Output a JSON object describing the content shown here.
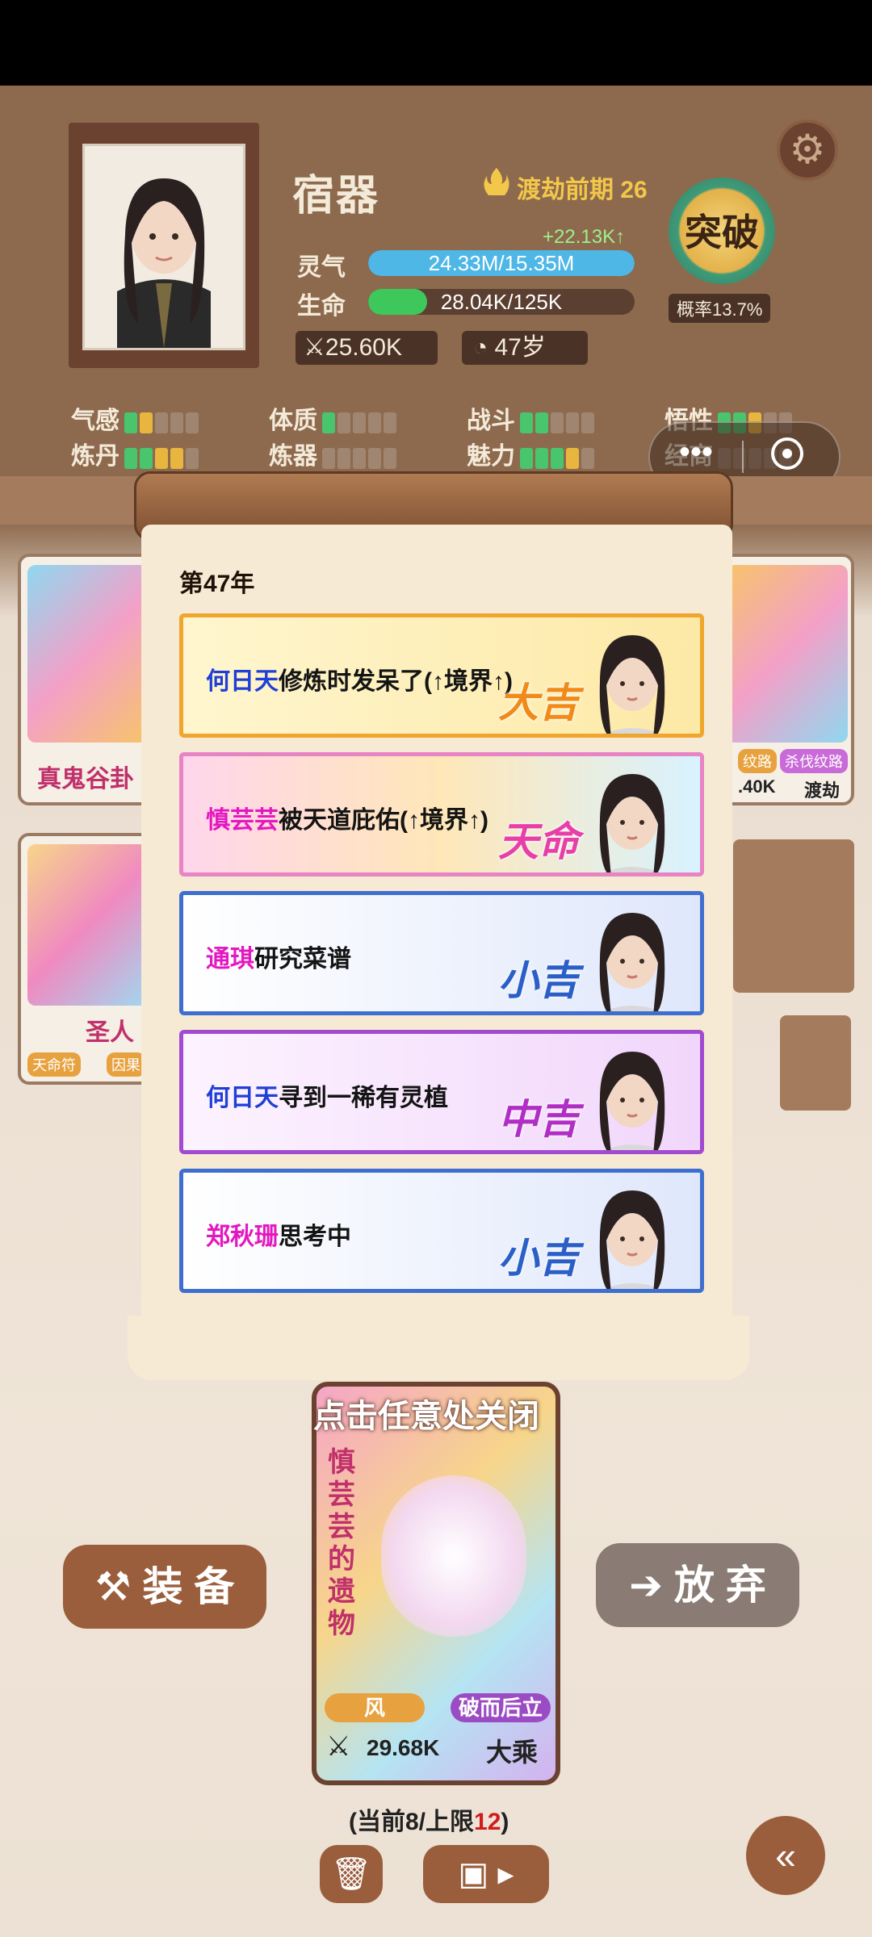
{
  "character": {
    "name": "宿器",
    "realm": "渡劫前期 26",
    "qi_gain": "+22.13K↑",
    "qi_label": "灵气",
    "qi_value": "24.33M/15.35M",
    "qi_fill": 1.0,
    "hp_label": "生命",
    "hp_value": "28.04K/125K",
    "hp_fill": 0.22,
    "power": "25.60K",
    "age": "47岁",
    "breakthrough_label": "突破",
    "breakthrough_prob": "概率13.7%"
  },
  "attributes": [
    {
      "label": "气感",
      "pips": [
        "g",
        "y",
        "n",
        "n",
        "n"
      ]
    },
    {
      "label": "体质",
      "pips": [
        "g",
        "n",
        "n",
        "n",
        "n"
      ]
    },
    {
      "label": "战斗",
      "pips": [
        "g",
        "g",
        "n",
        "n",
        "n"
      ]
    },
    {
      "label": "悟性",
      "pips": [
        "g",
        "g",
        "y",
        "n",
        "n"
      ]
    },
    {
      "label": "炼丹",
      "pips": [
        "g",
        "g",
        "y",
        "y",
        "n"
      ]
    },
    {
      "label": "炼器",
      "pips": [
        "n",
        "n",
        "n",
        "n",
        "n"
      ]
    },
    {
      "label": "魅力",
      "pips": [
        "g",
        "g",
        "g",
        "y",
        "n"
      ]
    },
    {
      "label": "经商",
      "pips": [
        "n",
        "n",
        "n",
        "n",
        "n"
      ]
    }
  ],
  "background": {
    "card1_label": "真鬼谷卦",
    "card2_label": "圣人",
    "card2_tags": [
      "天命符",
      "因果"
    ],
    "card3_tags": [
      "纹路",
      "杀伐纹路"
    ],
    "card3_stats": [
      ".40K",
      "渡劫"
    ]
  },
  "log": {
    "year": "第47年",
    "events": [
      {
        "name": "何日天",
        "name_color": "#1f3fd6",
        "text": "修炼时发呆了(↑境界↑)",
        "tag": "大吉",
        "tag_color": "#f08a18",
        "theme": "gold"
      },
      {
        "name": "慎芸芸",
        "name_color": "#e418c0",
        "text": "被天道庇佑(↑境界↑)",
        "tag": "天命",
        "tag_color": "#e83ea8",
        "theme": "rainbow"
      },
      {
        "name": "通琪",
        "name_color": "#e418c0",
        "text": "研究菜谱",
        "tag": "小吉",
        "tag_color": "#2a5fc8",
        "theme": "blue"
      },
      {
        "name": "何日天",
        "name_color": "#1f3fd6",
        "text": "寻到一稀有灵植",
        "tag": "中吉",
        "tag_color": "#b02ec4",
        "theme": "purple"
      },
      {
        "name": "郑秋珊",
        "name_color": "#e418c0",
        "text": "思考中",
        "tag": "小吉",
        "tag_color": "#2a5fc8",
        "theme": "blue"
      }
    ]
  },
  "bottom": {
    "close_hint": "点击任意处关闭",
    "equip_label": "装 备",
    "discard_label": "放 弃",
    "item_name": "慎芸芸的遗物",
    "item_tag1": "风",
    "item_tag2": "破而后立",
    "item_power": "29.68K",
    "item_realm": "大乘",
    "capacity_prefix": "(当前8/上限",
    "capacity_limit": "12",
    "capacity_suffix": ")"
  },
  "colors": {
    "accent_green": "#48c56d",
    "accent_yellow": "#e8b63e",
    "qi_bar": "#4fb7e6",
    "hp_bar": "#3ec85b",
    "wood": "#6b4130"
  }
}
